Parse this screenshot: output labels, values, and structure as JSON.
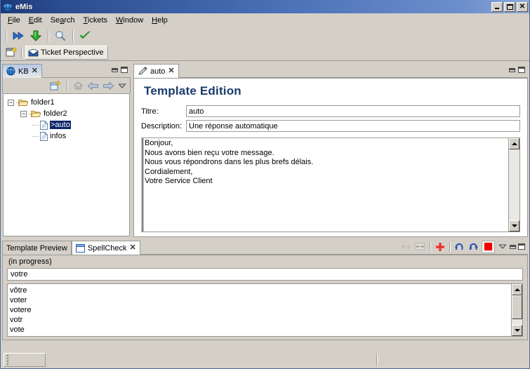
{
  "window": {
    "title": "eMis",
    "icon": "globe-icon",
    "buttons": {
      "minimize": "_",
      "maximize": "□",
      "close": "✕"
    }
  },
  "menubar": {
    "items": [
      {
        "label": "File",
        "mnemonic": "F"
      },
      {
        "label": "Edit",
        "mnemonic": "E"
      },
      {
        "label": "Search",
        "mnemonic": "a"
      },
      {
        "label": "Tickets",
        "mnemonic": "T"
      },
      {
        "label": "Window",
        "mnemonic": "W"
      },
      {
        "label": "Help",
        "mnemonic": "H"
      }
    ]
  },
  "toolbar": {
    "buttons": [
      {
        "name": "fast-forward-icon",
        "title": "Next"
      },
      {
        "name": "download-arrow-icon",
        "title": "Get"
      },
      {
        "name": "search-magnifier-icon",
        "title": "Search"
      },
      {
        "name": "check-mark-icon",
        "title": "Validate"
      }
    ]
  },
  "perspective_bar": {
    "open_perspective_icon": "open-perspective-icon",
    "active": {
      "label": "Ticket Perspective",
      "icon": "envelope-icon"
    }
  },
  "kb_view": {
    "tab": {
      "label": "KB",
      "icon": "globe-icon",
      "close": "✕"
    },
    "controls": {
      "minimize": "minimize-icon",
      "maximize": "maximize-icon"
    },
    "toolbar": [
      {
        "name": "new-folder-icon"
      },
      {
        "name": "home-icon"
      },
      {
        "name": "back-arrow-icon"
      },
      {
        "name": "forward-arrow-icon"
      },
      {
        "name": "view-menu-icon"
      }
    ],
    "tree": [
      {
        "label": "folder1",
        "type": "folder",
        "depth": 0,
        "expanded": true,
        "selected": false
      },
      {
        "label": "folder2",
        "type": "folder",
        "depth": 1,
        "expanded": true,
        "selected": false
      },
      {
        "label": ">auto",
        "type": "file",
        "depth": 2,
        "expanded": null,
        "selected": true
      },
      {
        "label": "infos",
        "type": "file",
        "depth": 2,
        "expanded": null,
        "selected": false
      }
    ]
  },
  "editor": {
    "tab": {
      "label": "auto",
      "icon": "pencil-icon",
      "close": "✕"
    },
    "controls": {
      "minimize": "minimize-icon",
      "maximize": "maximize-icon"
    },
    "heading": "Template Edition",
    "fields": [
      {
        "label": "Titre:",
        "value": "auto",
        "name": "titre-field"
      },
      {
        "label": "Description:",
        "value": "Une réponse automatique",
        "name": "description-field"
      }
    ],
    "body_text": "Bonjour,\nNous avons bien reçu votre message.\nNous vous répondrons dans les plus brefs délais.\nCordialement,\nVotre Service Client"
  },
  "bottom_view": {
    "tabs": [
      {
        "label": "Template Preview",
        "active": false,
        "icon": null,
        "closeable": false
      },
      {
        "label": "SpellCheck",
        "active": true,
        "icon": "window-icon",
        "closeable": true,
        "close": "✕"
      }
    ],
    "toolbar": [
      {
        "name": "prev-occurrence-icon",
        "enabled": false
      },
      {
        "name": "next-occurrence-icon",
        "enabled": false
      },
      {
        "name": "add-icon",
        "enabled": true,
        "color": "#e8312a"
      },
      {
        "name": "undo-icon",
        "enabled": true,
        "color": "#2a55b4"
      },
      {
        "name": "redo-icon",
        "enabled": true,
        "color": "#2a55b4"
      },
      {
        "name": "stop-icon",
        "enabled": true,
        "color": "#ee0000"
      },
      {
        "name": "view-menu-icon",
        "enabled": true
      },
      {
        "name": "minimize-icon",
        "enabled": true
      },
      {
        "name": "maximize-icon",
        "enabled": true
      }
    ],
    "status": "(in progress)",
    "word_value": "votre",
    "suggestions": [
      "vôtre",
      "voter",
      "votere",
      "votr",
      "vote"
    ]
  },
  "colors": {
    "titlebar_start": "#1f3a7a",
    "titlebar_end": "#8fa9d8",
    "chrome": "#d4d0c8",
    "heading": "#1b3a6b",
    "selection": "#0a246a",
    "accent_red": "#e8312a",
    "accent_blue": "#2a55b4"
  }
}
